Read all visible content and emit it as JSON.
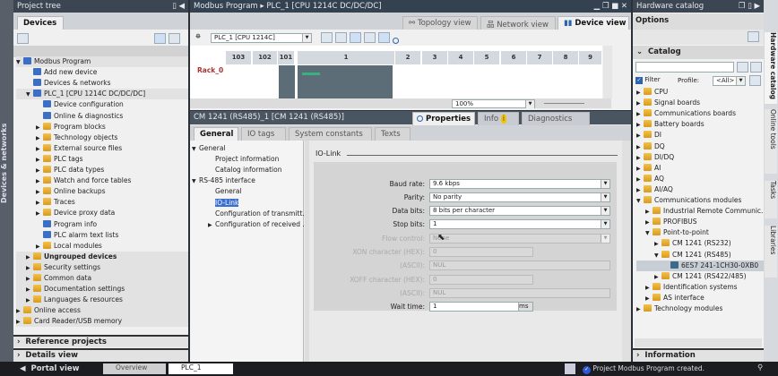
{
  "left_strip": {
    "label": "Devices & networks"
  },
  "project_tree": {
    "title": "Project tree",
    "tab": "Devices",
    "items": [
      {
        "label": "Modbus Program",
        "level": 0,
        "exp": "open",
        "icon": "project"
      },
      {
        "label": "Add new device",
        "level": 1,
        "exp": "",
        "icon": "add-device"
      },
      {
        "label": "Devices & networks",
        "level": 1,
        "exp": "",
        "icon": "network"
      },
      {
        "label": "PLC_1 [CPU 1214C DC/DC/DC]",
        "level": 1,
        "exp": "open",
        "icon": "plc",
        "selected": true
      },
      {
        "label": "Device configuration",
        "level": 2,
        "exp": "",
        "icon": "device-config"
      },
      {
        "label": "Online & diagnostics",
        "level": 2,
        "exp": "",
        "icon": "diagnostics"
      },
      {
        "label": "Program blocks",
        "level": 2,
        "exp": "closed",
        "icon": "folder"
      },
      {
        "label": "Technology objects",
        "level": 2,
        "exp": "closed",
        "icon": "folder"
      },
      {
        "label": "External source files",
        "level": 2,
        "exp": "closed",
        "icon": "folder"
      },
      {
        "label": "PLC tags",
        "level": 2,
        "exp": "closed",
        "icon": "folder"
      },
      {
        "label": "PLC data types",
        "level": 2,
        "exp": "closed",
        "icon": "folder"
      },
      {
        "label": "Watch and force tables",
        "level": 2,
        "exp": "closed",
        "icon": "folder"
      },
      {
        "label": "Online backups",
        "level": 2,
        "exp": "closed",
        "icon": "folder"
      },
      {
        "label": "Traces",
        "level": 2,
        "exp": "closed",
        "icon": "folder"
      },
      {
        "label": "Device proxy data",
        "level": 2,
        "exp": "closed",
        "icon": "folder"
      },
      {
        "label": "Program info",
        "level": 2,
        "exp": "",
        "icon": "program-info"
      },
      {
        "label": "PLC alarm text lists",
        "level": 2,
        "exp": "",
        "icon": "alarm-list"
      },
      {
        "label": "Local modules",
        "level": 2,
        "exp": "closed",
        "icon": "folder"
      },
      {
        "label": "Ungrouped devices",
        "level": 1,
        "exp": "closed",
        "icon": "folder",
        "bold": true
      },
      {
        "label": "Security settings",
        "level": 1,
        "exp": "closed",
        "icon": "folder"
      },
      {
        "label": "Common data",
        "level": 1,
        "exp": "closed",
        "icon": "folder"
      },
      {
        "label": "Documentation settings",
        "level": 1,
        "exp": "closed",
        "icon": "folder"
      },
      {
        "label": "Languages & resources",
        "level": 1,
        "exp": "closed",
        "icon": "folder"
      },
      {
        "label": "Online access",
        "level": 0,
        "exp": "closed",
        "icon": "folder"
      },
      {
        "label": "Card Reader/USB memory",
        "level": 0,
        "exp": "closed",
        "icon": "folder"
      }
    ],
    "reference_projects": "Reference projects",
    "details_view": "Details view"
  },
  "editor": {
    "breadcrumb": [
      "Modbus Program",
      "PLC_1 [CPU 1214C DC/DC/DC]"
    ],
    "view_tabs": [
      "Topology view",
      "Network view",
      "Device view"
    ],
    "device_select": "PLC_1 [CPU 1214C]",
    "rack_label": "Rack_0",
    "slots": [
      "103",
      "102",
      "101",
      "1",
      "2",
      "3",
      "4",
      "5",
      "6",
      "7",
      "8",
      "9"
    ],
    "zoom": "100%"
  },
  "properties": {
    "title": "CM 1241 (RS485)_1 [CM 1241 (RS485)]",
    "inspector_tabs": [
      "Properties",
      "Info",
      "Diagnostics"
    ],
    "tabs": [
      "General",
      "IO tags",
      "System constants",
      "Texts"
    ],
    "nav": [
      {
        "label": "General",
        "level": 0,
        "exp": "open"
      },
      {
        "label": "Project information",
        "level": 1,
        "exp": ""
      },
      {
        "label": "Catalog information",
        "level": 1,
        "exp": ""
      },
      {
        "label": "RS-485 interface",
        "level": 0,
        "exp": "open"
      },
      {
        "label": "General",
        "level": 1,
        "exp": ""
      },
      {
        "label": "IO-Link",
        "level": 1,
        "exp": "",
        "selected": true
      },
      {
        "label": "Configuration of transmitt...",
        "level": 1,
        "exp": ""
      },
      {
        "label": "Configuration of received ...",
        "level": 1,
        "exp": "closed"
      }
    ],
    "section_title": "IO-Link",
    "fields": {
      "baud_rate": {
        "label": "Baud rate:",
        "value": "9.6 kbps"
      },
      "parity": {
        "label": "Parity:",
        "value": "No parity"
      },
      "data_bits": {
        "label": "Data bits:",
        "value": "8 bits per character"
      },
      "stop_bits": {
        "label": "Stop bits:",
        "value": "1"
      },
      "flow_control": {
        "label": "Flow control:",
        "value": "None"
      },
      "xon_hex": {
        "label": "XON character (HEX):",
        "value": "0"
      },
      "xon_ascii": {
        "label": "(ASCII):",
        "value": "NUL"
      },
      "xoff_hex": {
        "label": "XOFF character (HEX):",
        "value": "0"
      },
      "xoff_ascii": {
        "label": "(ASCII):",
        "value": "NUL"
      },
      "wait_time": {
        "label": "Wait time:",
        "value": "1",
        "unit": "ms"
      }
    }
  },
  "catalog": {
    "title": "Hardware catalog",
    "options": "Options",
    "section": "Catalog",
    "search_value": "",
    "filter_label": "Filter",
    "profile_label": "Profile:",
    "profile_value": "<All>",
    "items": [
      {
        "label": "CPU",
        "level": 0,
        "exp": "closed"
      },
      {
        "label": "Signal boards",
        "level": 0,
        "exp": "closed"
      },
      {
        "label": "Communications boards",
        "level": 0,
        "exp": "closed"
      },
      {
        "label": "Battery boards",
        "level": 0,
        "exp": "closed"
      },
      {
        "label": "DI",
        "level": 0,
        "exp": "closed"
      },
      {
        "label": "DQ",
        "level": 0,
        "exp": "closed"
      },
      {
        "label": "DI/DQ",
        "level": 0,
        "exp": "closed"
      },
      {
        "label": "AI",
        "level": 0,
        "exp": "closed"
      },
      {
        "label": "AQ",
        "level": 0,
        "exp": "closed"
      },
      {
        "label": "AI/AQ",
        "level": 0,
        "exp": "closed"
      },
      {
        "label": "Communications modules",
        "level": 0,
        "exp": "open"
      },
      {
        "label": "Industrial Remote Communic...",
        "level": 1,
        "exp": "closed"
      },
      {
        "label": "PROFIBUS",
        "level": 1,
        "exp": "closed"
      },
      {
        "label": "Point-to-point",
        "level": 1,
        "exp": "open"
      },
      {
        "label": "CM 1241 (RS232)",
        "level": 2,
        "exp": "closed"
      },
      {
        "label": "CM 1241 (RS485)",
        "level": 2,
        "exp": "open"
      },
      {
        "label": "6ES7 241-1CH30-0XB0",
        "level": 3,
        "exp": "",
        "selected": true
      },
      {
        "label": "CM 1241 (RS422/485)",
        "level": 2,
        "exp": "closed"
      },
      {
        "label": "Identification systems",
        "level": 1,
        "exp": "closed"
      },
      {
        "label": "AS interface",
        "level": 1,
        "exp": "closed"
      },
      {
        "label": "Technology modules",
        "level": 0,
        "exp": "closed"
      }
    ],
    "information": "Information"
  },
  "right_strip": [
    "Hardware catalog",
    "Online tools",
    "Tasks",
    "Libraries"
  ],
  "taskbar": {
    "portal_view": "Portal view",
    "tabs": [
      "Overview",
      "PLC_1"
    ],
    "status": "Project Modbus Program created."
  }
}
